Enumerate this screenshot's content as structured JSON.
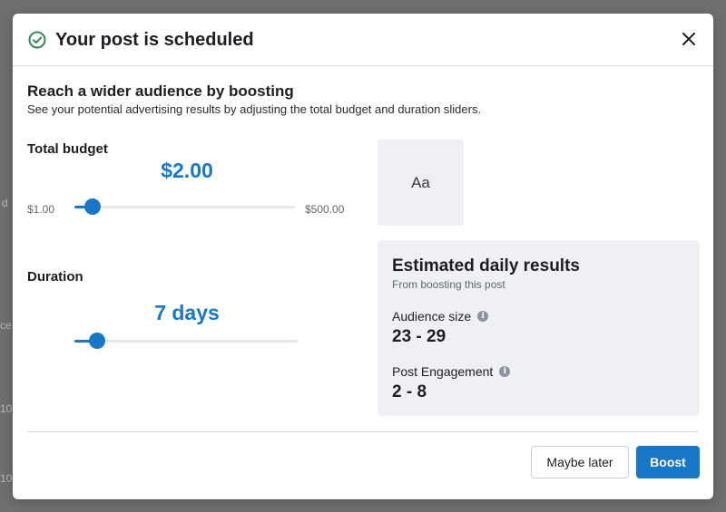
{
  "backdrop": {
    "fragments": [
      "d",
      "ce",
      "10",
      "10"
    ]
  },
  "dialog": {
    "title": "Your post is scheduled",
    "close_icon": "close-icon",
    "status_icon": "check-circle-icon",
    "heading": "Reach a wider audience by boosting",
    "subheading": "See your potential advertising results by adjusting the total budget and duration sliders."
  },
  "budget": {
    "label": "Total budget",
    "value": "$2.00",
    "min_label": "$1.00",
    "max_label": "$500.00",
    "slider_fraction": 0.08
  },
  "duration": {
    "label": "Duration",
    "value": "7 days",
    "slider_fraction": 0.1
  },
  "preview": {
    "text": "Aa"
  },
  "results": {
    "title": "Estimated daily results",
    "subtitle": "From boosting this post",
    "metrics": [
      {
        "label": "Audience size",
        "value": "23 - 29",
        "icon": "info-icon"
      },
      {
        "label": "Post Engagement",
        "value": "2 - 8",
        "icon": "info-icon"
      }
    ]
  },
  "footer": {
    "secondary_label": "Maybe later",
    "primary_label": "Boost"
  },
  "colors": {
    "accent": "#1877c9",
    "success": "#2e8b57"
  }
}
